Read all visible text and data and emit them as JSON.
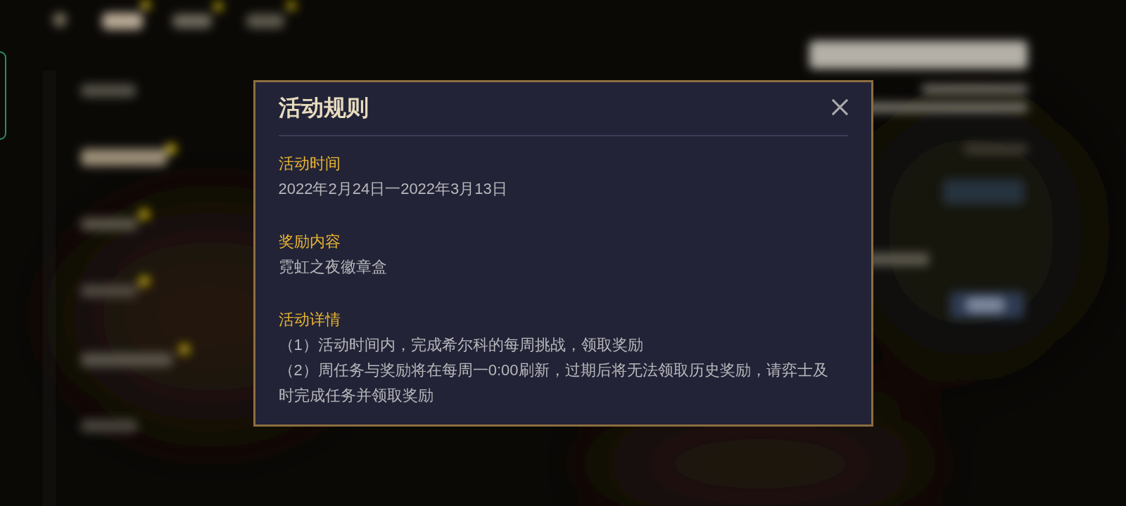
{
  "dialog": {
    "title": "活动规则",
    "sections": [
      {
        "heading": "活动时间",
        "lines": [
          "2022年2月24日一2022年3月13日"
        ]
      },
      {
        "heading": "奖励内容",
        "lines": [
          "霓虹之夜徽章盒"
        ]
      },
      {
        "heading": "活动详情",
        "lines": [
          "（1）活动时间内，完成希尔科的每周挑战，领取奖励",
          "（2）周任务与奖励将在每周一0:00刷新，过期后将无法领取历史奖励，请弈士及时完成任务并领取奖励"
        ]
      }
    ]
  }
}
